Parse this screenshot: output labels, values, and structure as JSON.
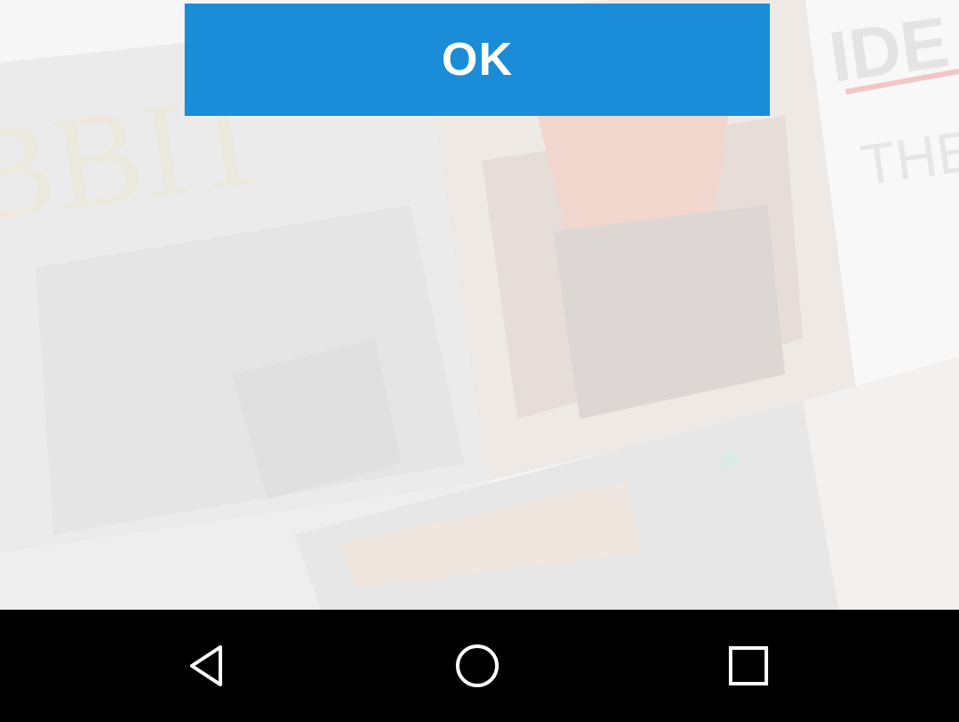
{
  "dialog": {
    "ok_label": "OK"
  },
  "background": {
    "card_left_title": "BBIT",
    "card_right_title": "IDE",
    "card_right_subtitle": "THE"
  },
  "navbar": {
    "back_icon": "back-triangle-icon",
    "home_icon": "home-circle-icon",
    "recents_icon": "recents-square-icon"
  },
  "colors": {
    "accent": "#1a8cd8",
    "navbar": "#000000",
    "icon": "#ffffff"
  }
}
